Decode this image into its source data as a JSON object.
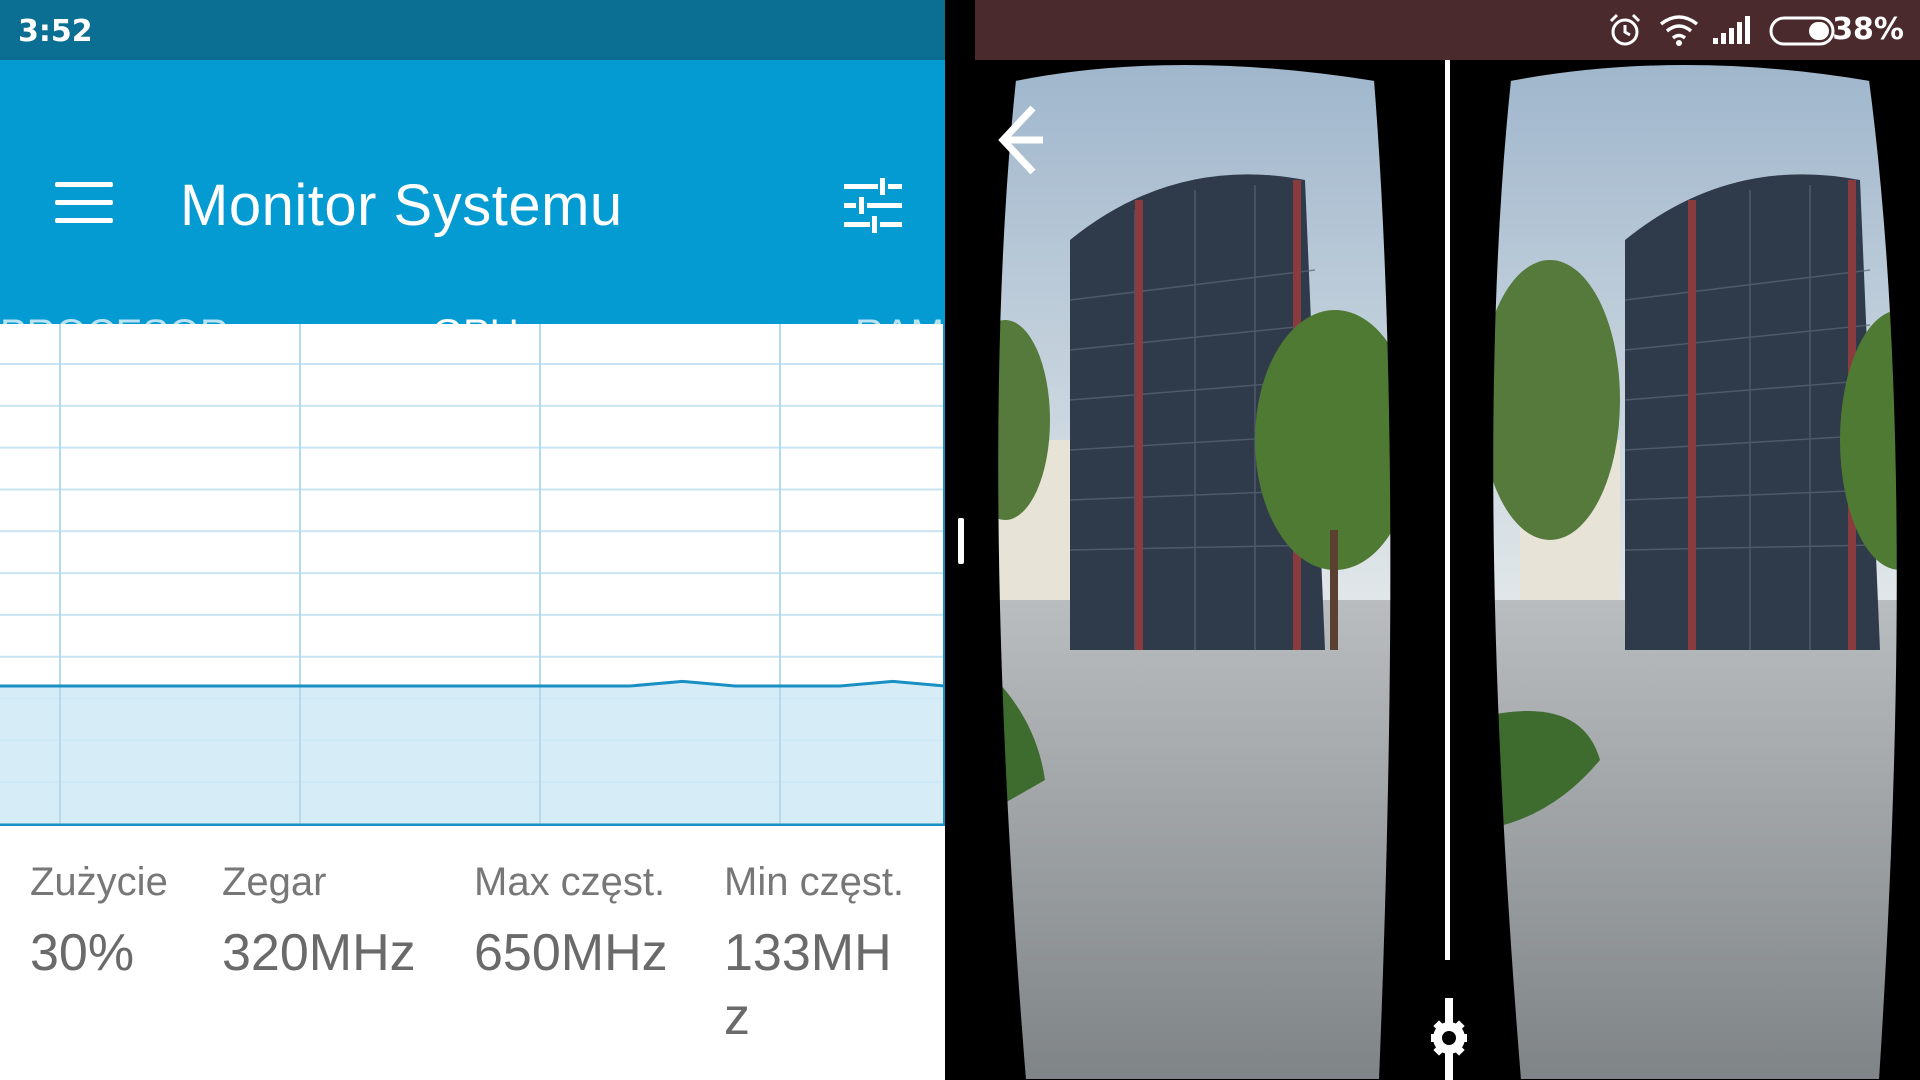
{
  "status_bar": {
    "time": "3:52",
    "battery": "38%"
  },
  "app": {
    "title": "Monitor Systemu",
    "tabs": [
      {
        "label": "PROCESOR",
        "selected": false
      },
      {
        "label": "GPU",
        "selected": true
      },
      {
        "label": "RAM",
        "selected": false
      }
    ]
  },
  "chart_data": {
    "type": "area",
    "title": "",
    "xlabel": "",
    "ylabel": "",
    "ylim": [
      0,
      100
    ],
    "grid": true,
    "series": [
      {
        "values": [
          30,
          30,
          30,
          30,
          30,
          30,
          30,
          30,
          30,
          30,
          30,
          30,
          30,
          31,
          30,
          30,
          30,
          31,
          30
        ]
      }
    ]
  },
  "stats": [
    {
      "label": "Zużycie",
      "value": "30%"
    },
    {
      "label": "Zegar",
      "value": "320MHz"
    },
    {
      "label": "Max częst.",
      "value": "650MHz"
    },
    {
      "label": "Min częst.",
      "value": "133MHz"
    }
  ],
  "colors": {
    "status_bar_left": "#0a6f93",
    "app_bar": "#049ad2",
    "status_bar_right": "#4a2a2d",
    "chart_line": "#1a8fc4",
    "chart_fill": "#cfeaf6"
  },
  "icons": {
    "menu": "menu-icon",
    "settings": "tune-icon",
    "back": "back-arrow-icon",
    "vr_settings": "gear-icon",
    "alarm": "alarm-icon",
    "wifi": "wifi-icon",
    "signal": "signal-icon",
    "battery": "battery-icon"
  }
}
